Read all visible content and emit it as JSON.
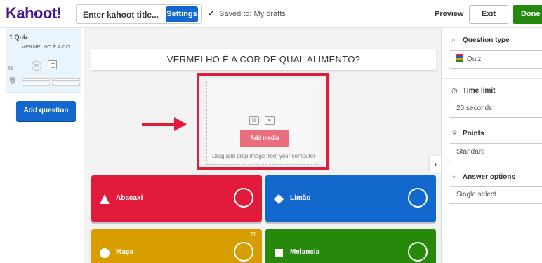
{
  "topbar": {
    "logo": "Kahoot!",
    "title_placeholder": "Enter kahoot title...",
    "settings_label": "Settings",
    "saved_text": "Saved to: My drafts",
    "preview_label": "Preview",
    "exit_label": "Exit",
    "done_label": "Done"
  },
  "sidebar": {
    "slide_number_label": "1 Quiz",
    "slide_question_preview": "VERMELHO É A CO...",
    "slide_timer": "20",
    "add_question_label": "Add question"
  },
  "canvas": {
    "question": "VERMELHO É A COR DE QUAL ALIMENTO?",
    "add_media_label": "Add media",
    "drag_text": "Drag and drop image from your computer",
    "answers": [
      {
        "label": "Abacaxi",
        "color": "#e21b3c",
        "shape": "triangle-icon"
      },
      {
        "label": "Limão",
        "color": "#1368ce",
        "shape": "diamond-icon"
      },
      {
        "label": "Maça",
        "color": "#d89e00",
        "shape": "circle-icon",
        "char_count": "71"
      },
      {
        "label": "Melancia",
        "color": "#26890c",
        "shape": "square-icon"
      }
    ]
  },
  "right_panel": {
    "question_type_title": "Question type",
    "question_type_value": "Quiz",
    "time_limit_title": "Time limit",
    "time_limit_value": "20 seconds",
    "points_title": "Points",
    "points_value": "Standard",
    "answer_options_title": "Answer options",
    "answer_options_value": "Single select"
  },
  "colors": {
    "brand_purple": "#46178f",
    "primary_blue": "#1368ce",
    "done_green": "#26890c",
    "highlight_red": "#e21b3c"
  }
}
